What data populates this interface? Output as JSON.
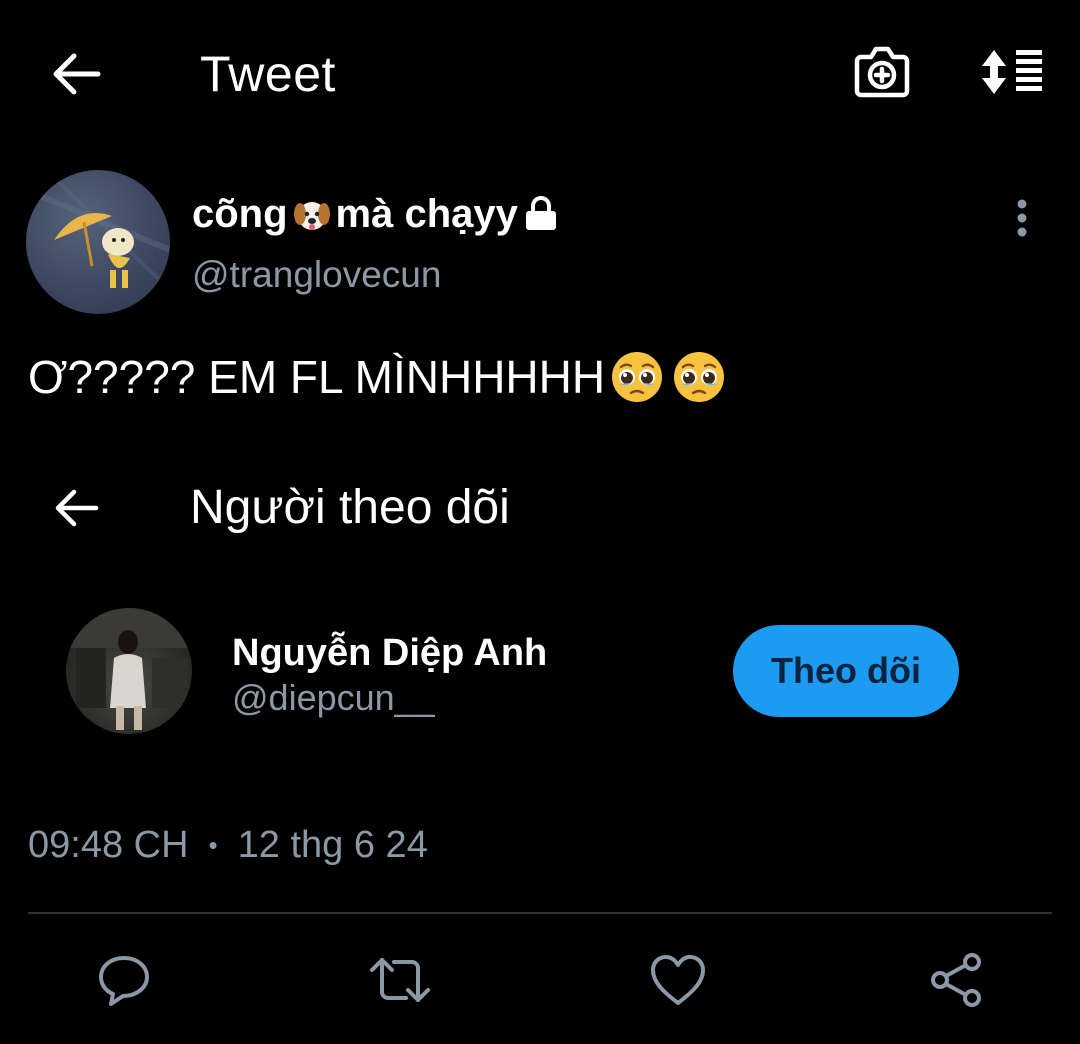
{
  "header": {
    "title": "Tweet",
    "icons": {
      "back": "arrow-left-icon",
      "camera": "camera-plus-icon",
      "sort": "sort-icon"
    }
  },
  "author": {
    "name": "cõng",
    "name_suffix": "mà chạyy",
    "name_emoji": "dog-face-emoji",
    "locked_icon": "lock-icon",
    "handle": "@tranglovecun"
  },
  "tweet": {
    "text": "Ơ????? EM FL MÌNHHHHH",
    "trailing_emojis": [
      "pleading-face-emoji",
      "pleading-face-emoji"
    ]
  },
  "embedded": {
    "title": "Người theo dõi",
    "follower": {
      "name": "Nguyễn Diệp Anh",
      "handle": "@diepcun__",
      "follow_label": "Theo dõi"
    }
  },
  "meta": {
    "time": "09:48 CH",
    "separator": "•",
    "date": "12 thg 6 24"
  },
  "actions": {
    "icons": [
      "reply-icon",
      "retweet-icon",
      "like-icon",
      "share-icon"
    ]
  },
  "colors": {
    "background": "#000000",
    "text_primary": "#ffffff",
    "text_secondary": "#8b98a5",
    "accent": "#1d9bf0",
    "divider": "#2f3336"
  }
}
